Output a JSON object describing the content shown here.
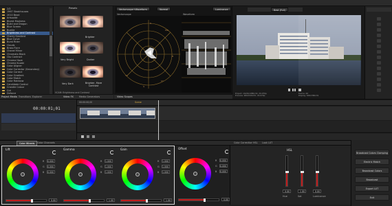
{
  "tree": {
    "items": [
      "2/3",
      "1967 Steakhouses",
      "2010 Bead",
      "Artsoolbt",
      "Bluest Madness",
      "Build and Dragon",
      "Blue Screen",
      "Buckle",
      "Brightness and Contrast",
      "Cherry Gradient",
      "Blue Curve",
      "Burst Rider",
      "Clouds",
      "Brass Flare",
      "Chanel Minor",
      "Chromata Black",
      "Clip Contract",
      "Chroma Haze",
      "Chroma Kuzaki",
      "Color Aligner",
      "Color Corrector (Secondary)",
      "Color Correct",
      "Color Gradient",
      "Color Match",
      "Color Rainbow",
      "Candidate Control",
      "Crandle Colour",
      "Cut",
      "Deforce"
    ],
    "selected_index": 8,
    "tabs": [
      "Project Media",
      "Transitions",
      "Explorer"
    ]
  },
  "presets": {
    "header": "Presets",
    "items": [
      {
        "label": "Brighter"
      },
      {
        "label": "Very Bright"
      },
      {
        "label": "Darker"
      },
      {
        "label": "Very Dark"
      },
      {
        "label": "Brighter, More Contrast"
      }
    ],
    "footer": "VCAM: Brightness and Contrast",
    "tabs": [
      "Video FX",
      "Media Generators"
    ]
  },
  "scopes": {
    "tabs": [
      "Vectorscope+Waveform",
      "Normal",
      "Luminance"
    ],
    "labels": [
      "Vectorscope",
      "Waveform"
    ],
    "footer_tab": "Video Scopes"
  },
  "viewer": {
    "dropdown": "Best (Full)",
    "info": [
      "Project:  1920x1080x32, 29.970p",
      "Preview:  960x540x32, 29.970p",
      "Frame:  40",
      "Display:  640x360x32"
    ],
    "footer_tab": "Video Preview"
  },
  "timeline": {
    "timecode": "00:00:01;01",
    "ruler_label": "00:00:00;00",
    "marker": "Scene"
  },
  "bottombar": {
    "tabs": [
      "Color Wheels",
      "Color Channels",
      "Color Correction",
      "HSL",
      "Look LUT"
    ],
    "right_tab": "Finishing"
  },
  "wheels": [
    {
      "title": "Lift",
      "values": [
        "0.000",
        "0.000",
        "0.000"
      ],
      "slider_value": "0.00"
    },
    {
      "title": "Gamma",
      "values": [
        "1.000",
        "1.000",
        "1.000"
      ],
      "slider_value": "1.00"
    },
    {
      "title": "Gain",
      "values": [
        "1.000",
        "1.000",
        "1.000"
      ],
      "slider_value": "1.00"
    },
    {
      "title": "Offset",
      "values": [
        "0.000",
        "0.000",
        "0.000"
      ],
      "slider_value": "0.00"
    }
  ],
  "hsl": {
    "title": "HSL",
    "sliders": [
      {
        "label": "Hue",
        "value": "0.00",
        "level": 0.45
      },
      {
        "label": "Sat",
        "value": "1.00",
        "level": 0.45
      },
      {
        "label": "Luminance",
        "value": "0.00",
        "level": 0.45
      }
    ]
  },
  "actions": [
    "Broadcast Colors Clamping",
    "Electric Match",
    "Broadcast Colors",
    "Broadcast",
    "Export LUT",
    "Exit"
  ]
}
